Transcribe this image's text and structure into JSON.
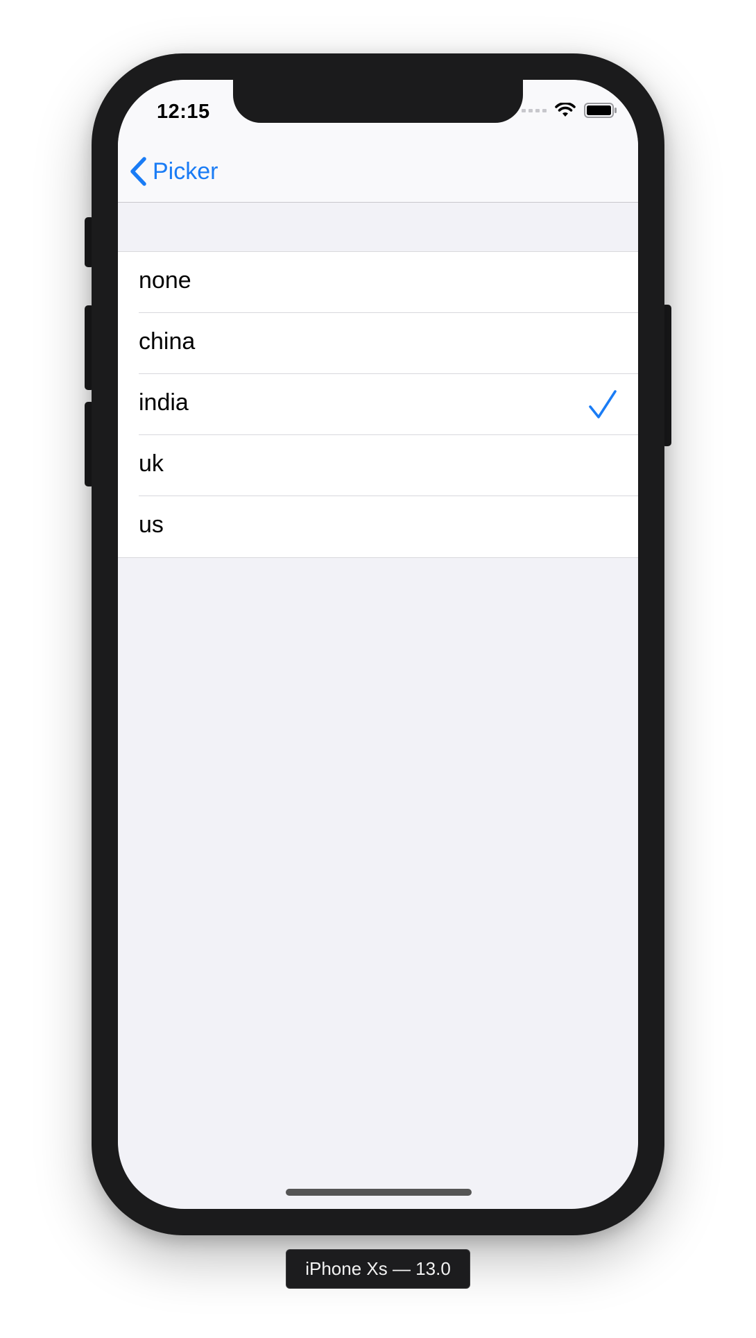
{
  "status_bar": {
    "time": "12:15",
    "icons": [
      "cellular-signal-icon",
      "wifi-icon",
      "battery-icon"
    ]
  },
  "nav": {
    "back_label": "Picker",
    "back_icon": "chevron-left-icon"
  },
  "list": {
    "items": [
      {
        "label": "none",
        "selected": false
      },
      {
        "label": "china",
        "selected": false
      },
      {
        "label": "india",
        "selected": true
      },
      {
        "label": "uk",
        "selected": false
      },
      {
        "label": "us",
        "selected": false
      }
    ],
    "selected_icon": "checkmark-icon"
  },
  "device_label": "iPhone Xs — 13.0",
  "colors": {
    "accent": "#1a7cf5",
    "background": "#f2f2f7",
    "cell": "#ffffff",
    "frame": "#1b1b1c"
  }
}
